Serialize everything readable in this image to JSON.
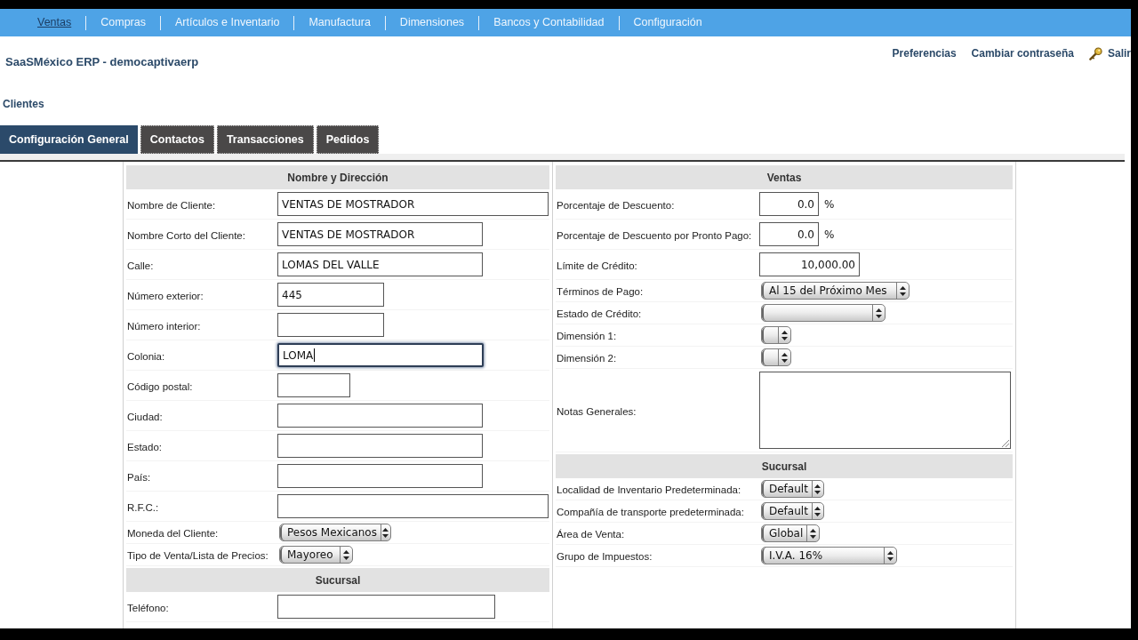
{
  "menu_bar": {
    "items": [
      {
        "label": "Ventas",
        "selected": true
      },
      {
        "label": "Compras",
        "selected": false
      },
      {
        "label": "Artículos e Inventario",
        "selected": false
      },
      {
        "label": "Manufactura",
        "selected": false
      },
      {
        "label": "Dimensiones",
        "selected": false
      },
      {
        "label": "Bancos y Contabilidad",
        "selected": false
      },
      {
        "label": "Configuración",
        "selected": false
      }
    ]
  },
  "header": {
    "title": "SaaSMéxico ERP - democaptivaerp",
    "links": [
      {
        "label": "Preferencias",
        "kind": "text"
      },
      {
        "label": "Cambiar contraseña",
        "kind": "text"
      },
      {
        "label": "Salir",
        "kind": "key"
      }
    ]
  },
  "page_title": "Clientes",
  "tabs": [
    {
      "label": "Configuración General",
      "selected": true
    },
    {
      "label": "Contactos",
      "selected": false
    },
    {
      "label": "Transacciones",
      "selected": false
    },
    {
      "label": "Pedidos",
      "selected": false
    }
  ],
  "form": {
    "columns": [
      {
        "sections": [
          {
            "title": "Nombre y Dirección",
            "fields": [
              {
                "label": "Nombre de Cliente:",
                "kind": "text",
                "value": "VENTAS DE MOSTRADOR",
                "focused": false
              },
              {
                "label": "Nombre Corto del Cliente:",
                "kind": "text",
                "value": "VENTAS DE MOSTRADOR",
                "focused": false
              },
              {
                "label": "Calle:",
                "kind": "text",
                "value": "LOMAS DEL VALLE",
                "focused": false
              },
              {
                "label": "Número exterior:",
                "kind": "text",
                "value": "445",
                "focused": false
              },
              {
                "label": "Número interior:",
                "kind": "text",
                "focused": false
              },
              {
                "label": "Colonia:",
                "kind": "text",
                "value": "LOMA",
                "focused": true
              },
              {
                "label": "Código postal:",
                "kind": "text",
                "focused": false
              },
              {
                "label": "Ciudad:",
                "kind": "text",
                "focused": false
              },
              {
                "label": "Estado:",
                "kind": "text",
                "focused": false
              },
              {
                "label": "País:",
                "kind": "text",
                "focused": false
              },
              {
                "label": "R.F.C.:",
                "kind": "text",
                "focused": false
              },
              {
                "label": "Moneda del Cliente:",
                "kind": "select",
                "value": "Pesos Mexicanos",
                "focused": false
              },
              {
                "label": "Tipo de Venta/Lista de Precios:",
                "kind": "select",
                "value": "Mayoreo",
                "focused": false
              }
            ]
          },
          {
            "title": "Sucursal",
            "fields": [
              {
                "label": "Teléfono:",
                "kind": "text",
                "focused": false
              }
            ]
          }
        ]
      },
      {
        "sections": [
          {
            "title": "Ventas",
            "fields": [
              {
                "label": "Porcentaje de Descuento:",
                "kind": "percent",
                "value": "0.0",
                "suffix": "%",
                "focused": false
              },
              {
                "label": "Porcentaje de Descuento por Pronto Pago:",
                "kind": "percent",
                "value": "0.0",
                "suffix": "%",
                "focused": false
              },
              {
                "label": "Límite de Crédito:",
                "kind": "number",
                "value": "10,000.00",
                "focused": false
              },
              {
                "label": "Términos de Pago:",
                "kind": "select",
                "value": "Al 15 del Próximo Mes",
                "focused": false
              },
              {
                "label": "Estado de Crédito:",
                "kind": "select",
                "focused": false
              },
              {
                "label": "Dimensión 1:",
                "kind": "select",
                "focused": false
              },
              {
                "label": "Dimensión 2:",
                "kind": "select",
                "focused": false
              },
              {
                "label": "Notas Generales:",
                "kind": "textarea",
                "focused": false
              }
            ]
          },
          {
            "title": "Sucursal",
            "fields": [
              {
                "label": "Localidad de Inventario Predeterminada:",
                "kind": "select",
                "value": "Default",
                "focused": false
              },
              {
                "label": "Compañía de transporte predeterminada:",
                "kind": "select",
                "value": "Default",
                "focused": false
              },
              {
                "label": "Área de Venta:",
                "kind": "select",
                "value": "Global",
                "focused": false
              },
              {
                "label": "Grupo de Impuestos:",
                "kind": "select",
                "value": "I.V.A. 16%",
                "focused": false
              }
            ]
          }
        ]
      }
    ]
  }
}
